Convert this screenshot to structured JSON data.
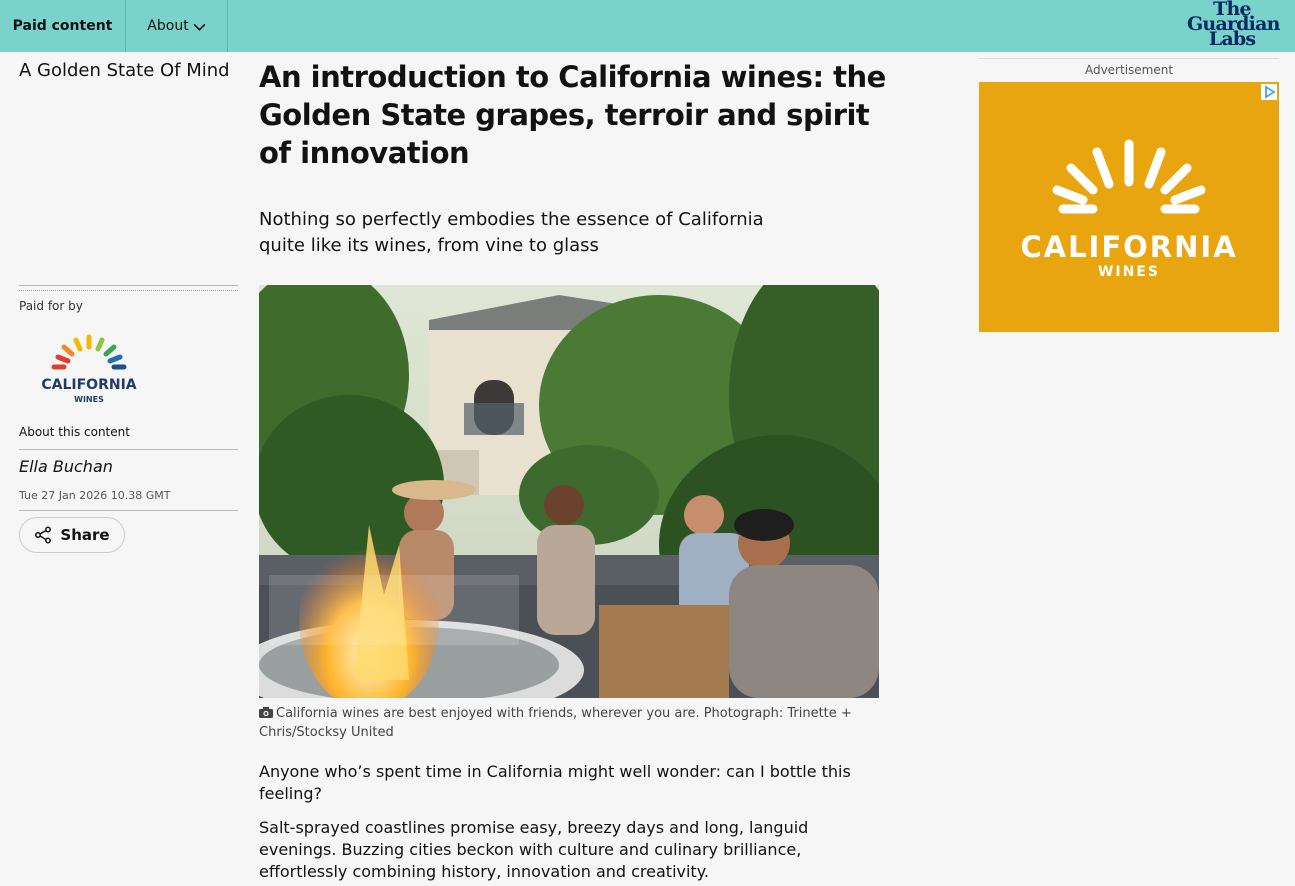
{
  "topbar": {
    "paid_label": "Paid content",
    "about_label": "About",
    "logo_lines": [
      "The",
      "Guardian",
      "Labs"
    ]
  },
  "sidebar": {
    "series_title": "A Golden State Of Mind",
    "paid_for_label": "Paid for by",
    "sponsor_logo_text": "CALIFORNIA",
    "sponsor_logo_sub": "WINES",
    "about_content_label": "About this content",
    "byline": "Ella Buchan",
    "dateline": "Tue 27 Jan 2026 10.38 GMT",
    "share_label": "Share"
  },
  "article": {
    "headline": "An introduction to California wines: the Golden State grapes, terroir and spirit of innovation",
    "standfirst": "Nothing so perfectly embodies the essence of California quite like its wines, from vine to glass",
    "image_caption": "California wines are best enjoyed with friends, wherever you are. Photograph: Trinette + Chris/Stocksy United",
    "paragraphs": [
      "Anyone who’s spent time in California might well wonder: can I bottle this feeling?",
      "Salt-sprayed coastlines promise easy, breezy days and long, languid evenings. Buzzing cities beckon with culture and culinary brilliance, effortlessly combining history, innovation and creativity."
    ]
  },
  "ad": {
    "label": "Advertisement",
    "brand": "CALIFORNIA",
    "sub": "WINES"
  },
  "colors": {
    "topbar": "#79d3cb",
    "ad_background": "#e8a50f",
    "logo_navy": "#052962"
  }
}
